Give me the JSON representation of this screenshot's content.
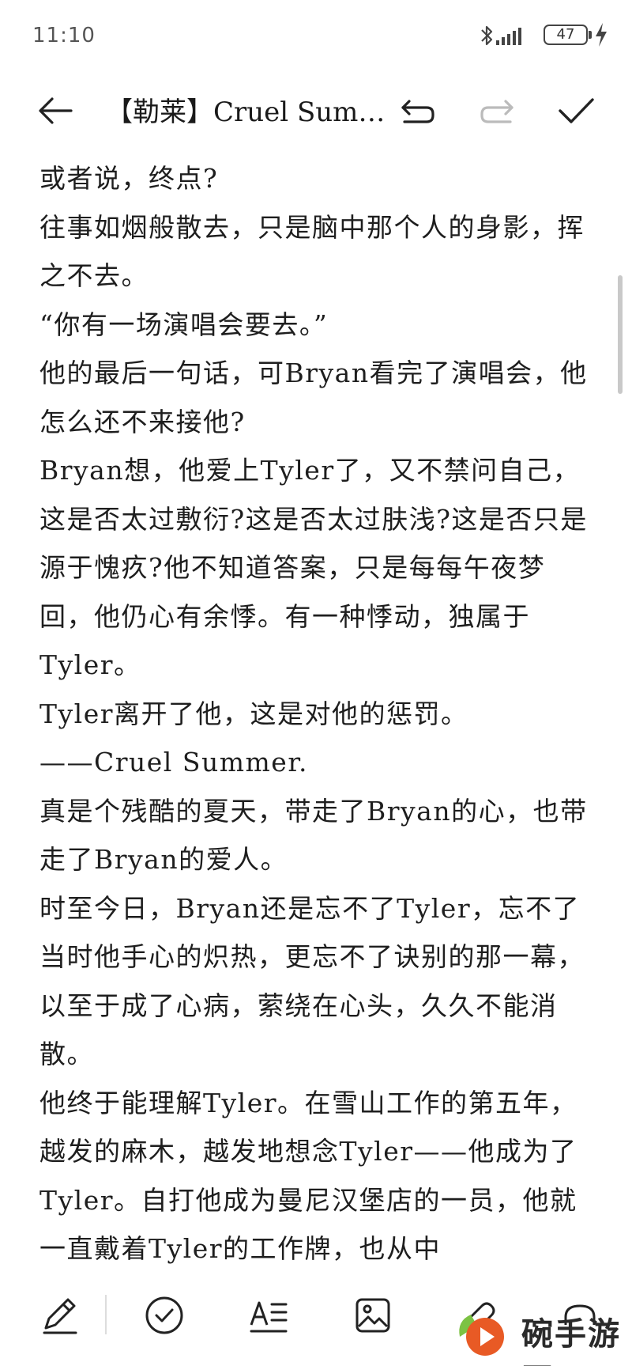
{
  "status_bar": {
    "time": "11:10",
    "battery_level": "47",
    "icons": [
      "bluetooth-icon",
      "signal-icon",
      "battery-icon",
      "charging-icon"
    ]
  },
  "toolbar": {
    "title": "【勒莱】Cruel Sum…",
    "icons": [
      "back-arrow-icon",
      "undo-icon",
      "redo-icon",
      "checkmark-icon"
    ]
  },
  "content": {
    "paragraphs": [
      "或者说，终点?",
      "往事如烟般散去，只是脑中那个人的身影，挥之不去。",
      "“你有一场演唱会要去。”",
      "他的最后一句话，可Bryan看完了演唱会，他怎么还不来接他?",
      "Bryan想，他爱上Tyler了，又不禁问自己，这是否太过敷衍?这是否太过肤浅?这是否只是源于愧疚?他不知道答案，只是每每午夜梦回，他仍心有余悸。有一种悸动，独属于Tyler。",
      "Tyler离开了他，这是对他的惩罚。",
      "——Cruel Summer.",
      "真是个残酷的夏天，带走了Bryan的心，也带走了Bryan的爱人。",
      "时至今日，Bryan还是忘不了Tyler，忘不了当时他手心的炽热，更忘不了诀别的那一幕，以至于成了心病，萦绕在心头，久久不能消散。",
      "他终于能理解Tyler。在雪山工作的第五年，越发的麻木，越发地想念Tyler——他成为了Tyler。自打他成为曼尼汉堡店的一员，他就一直戴着Tyler的工作牌，也从中"
    ]
  },
  "bottom_toolbar": {
    "icons": [
      "pen-icon",
      "checklist-icon",
      "text-format-icon",
      "image-icon",
      "attachment-icon",
      "audio-icon"
    ]
  },
  "watermark": {
    "text": "碗手游网"
  },
  "colors": {
    "text": "#1e1e1e",
    "icon": "#222222",
    "disabled_icon": "#bbbbbb",
    "background": "#ffffff"
  }
}
